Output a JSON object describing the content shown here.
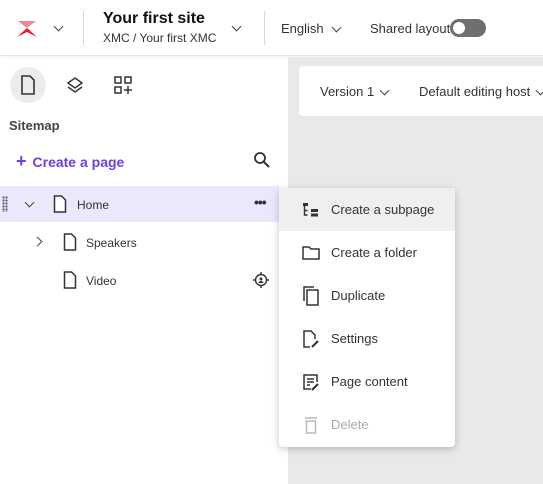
{
  "header": {
    "site_title": "Your first site",
    "site_path": "XMC / Your first XMC",
    "language": "English",
    "shared_layout_label": "Shared layout",
    "shared_layout_on": false,
    "brand_color": "#e8162b"
  },
  "toolbar": {
    "version": "Version 1",
    "editing_host": "Default editing host"
  },
  "sidebar": {
    "section_title": "Sitemap",
    "create_page_label": "Create a page",
    "accent_color": "#6b3fe0",
    "tree": [
      {
        "label": "Home",
        "expanded": true,
        "selected": true
      },
      {
        "label": "Speakers",
        "expanded": false
      },
      {
        "label": "Video"
      }
    ]
  },
  "context_menu": {
    "items": [
      {
        "label": "Create a subpage",
        "icon": "subpage-icon"
      },
      {
        "label": "Create a folder",
        "icon": "folder-icon"
      },
      {
        "label": "Duplicate",
        "icon": "duplicate-icon"
      },
      {
        "label": "Settings",
        "icon": "settings-page-icon"
      },
      {
        "label": "Page content",
        "icon": "page-content-icon"
      },
      {
        "label": "Delete",
        "icon": "trash-icon",
        "disabled": true
      }
    ]
  }
}
